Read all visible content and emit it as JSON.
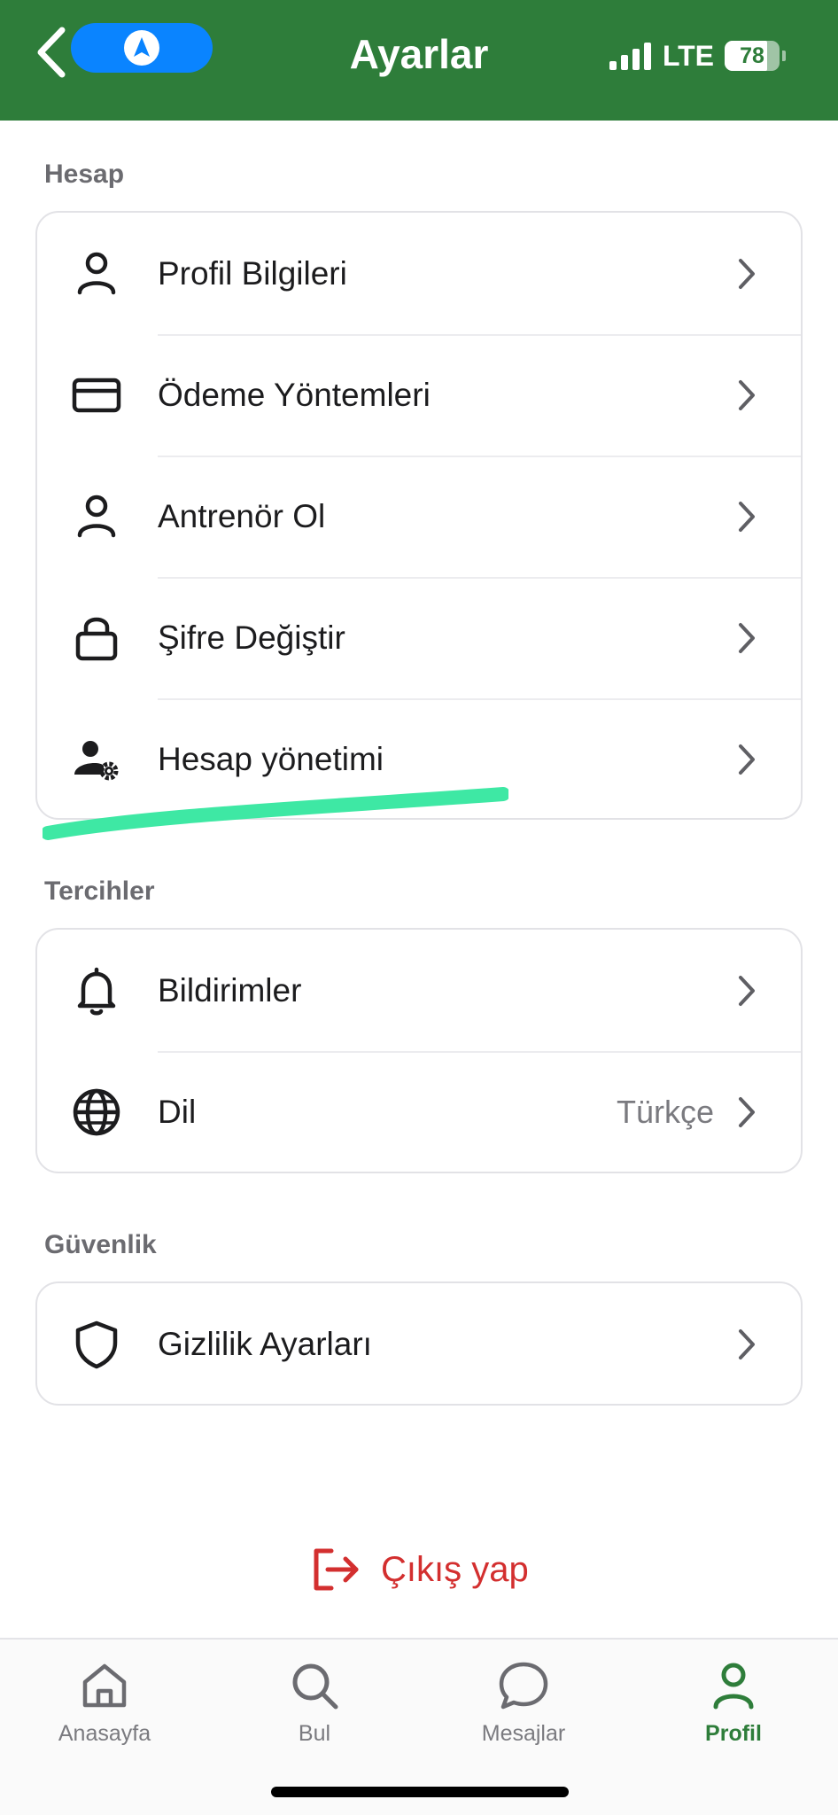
{
  "header": {
    "title": "Ayarlar"
  },
  "status": {
    "network": "LTE",
    "battery": "78",
    "battery_level": 0.78
  },
  "sections": [
    {
      "label": "Hesap",
      "items": [
        {
          "label": "Profil Bilgileri",
          "icon": "person-icon"
        },
        {
          "label": "Ödeme Yöntemleri",
          "icon": "credit-card-icon"
        },
        {
          "label": "Antrenör Ol",
          "icon": "person-icon"
        },
        {
          "label": "Şifre Değiştir",
          "icon": "lock-icon"
        },
        {
          "label": "Hesap yönetimi",
          "icon": "user-gear-icon"
        }
      ]
    },
    {
      "label": "Tercihler",
      "items": [
        {
          "label": "Bildirimler",
          "icon": "bell-icon"
        },
        {
          "label": "Dil",
          "value": "Türkçe",
          "icon": "globe-icon"
        }
      ]
    },
    {
      "label": "Güvenlik",
      "items": [
        {
          "label": "Gizlilik Ayarları",
          "icon": "shield-icon"
        }
      ]
    }
  ],
  "logout": {
    "label": "Çıkış yap",
    "color": "#d32f2f"
  },
  "tabbar": {
    "items": [
      {
        "label": "Anasayfa",
        "icon": "home-icon"
      },
      {
        "label": "Bul",
        "icon": "search-icon"
      },
      {
        "label": "Mesajlar",
        "icon": "chat-bubble-icon"
      },
      {
        "label": "Profil",
        "icon": "person-icon",
        "active": true
      }
    ]
  },
  "colors": {
    "header": "#2e7d3a",
    "accent": "#2e7d3a",
    "danger": "#d32f2f",
    "highlight_mark": "#3ee8a4"
  }
}
